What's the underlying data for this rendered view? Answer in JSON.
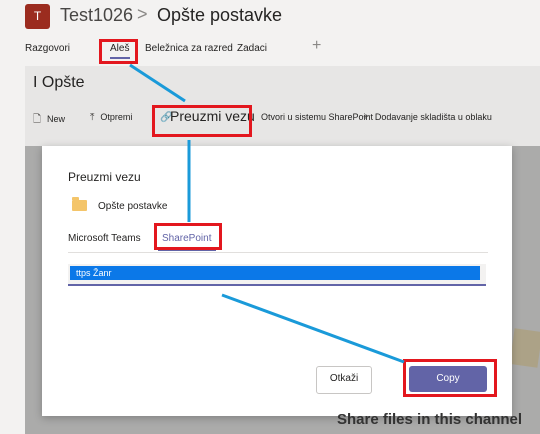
{
  "header": {
    "team_initial": "T",
    "team_name": "Test1026",
    "separator": ">",
    "channel_name": "Opšte postavke"
  },
  "tabs": [
    {
      "label": "Razgovori"
    },
    {
      "label": "Aleš"
    },
    {
      "label": "Beležnica za razred"
    },
    {
      "label": "Zadaci"
    }
  ],
  "add_tab": "+",
  "section_title": "I Opšte",
  "toolbar": {
    "new": "New",
    "upload": "Otpremi",
    "get_link": "Preuzmi vezu",
    "open_sharepoint": "Otvori u sistemu SharePoint",
    "add_cloud": "Dodavanje skladišta u oblaku"
  },
  "dialog": {
    "title": "Preuzmi vezu",
    "folder": "Opšte postavke",
    "tab_teams": "Microsoft Teams",
    "tab_sharepoint": "SharePoint",
    "link_value": "ttps Žanr",
    "cancel": "Otkaži",
    "copy": "Copy"
  },
  "background_text": "Share files in this channel",
  "colors": {
    "accent": "#6264a7",
    "highlight": "#e3171e",
    "callout": "#1a9ad9",
    "selection": "#0b78e8"
  }
}
